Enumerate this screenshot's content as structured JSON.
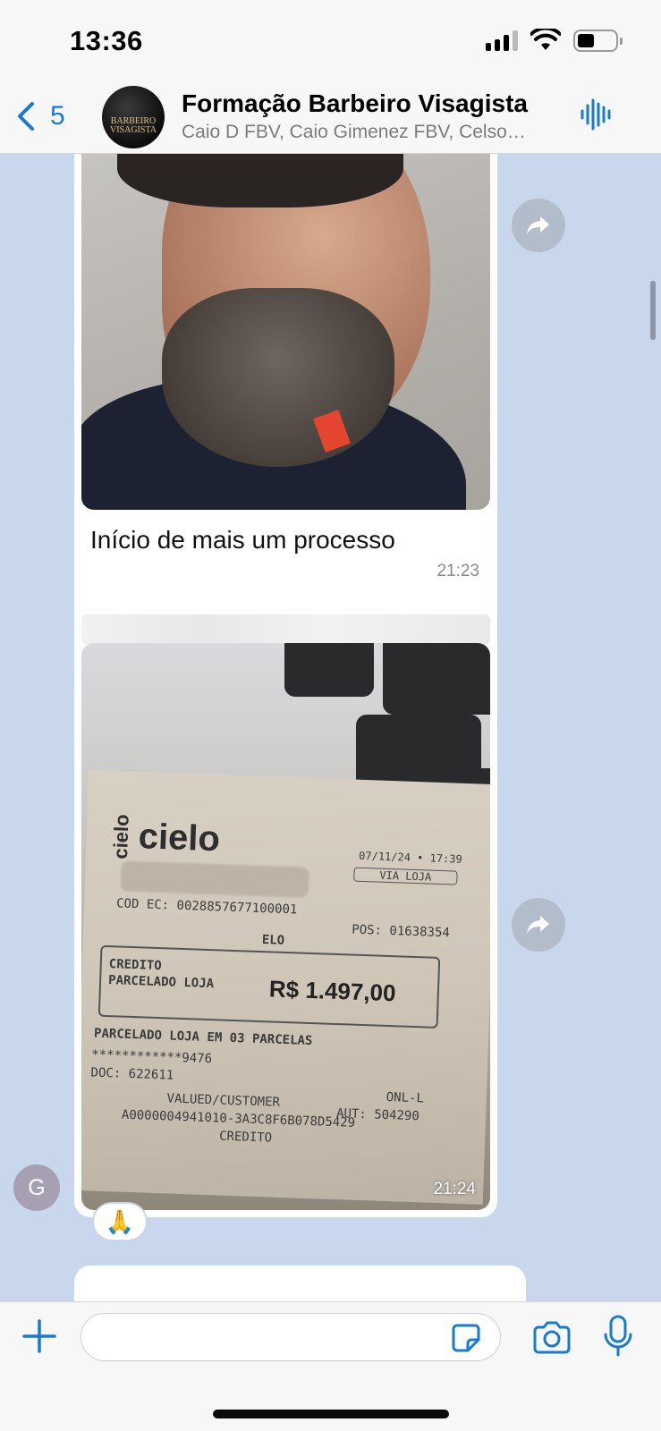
{
  "status_bar": {
    "time": "13:36",
    "battery_level_pct": 45
  },
  "header": {
    "back_count": "5",
    "title": "Formação Barbeiro Visagista",
    "members": "Caio D FBV, Caio Gimenez FBV, Celso…",
    "avatar_logo_line1": "BARBEIRO",
    "avatar_logo_line2": "VISAGISTA",
    "icons": [
      "chevron-left-icon",
      "voice-wave-icon"
    ]
  },
  "messages": [
    {
      "type": "image",
      "caption": "Início de mais um processo",
      "time": "21:23"
    },
    {
      "type": "image",
      "time": "21:24",
      "reaction": "🙏",
      "sender_initial": "G",
      "receipt": {
        "brand": "cielo",
        "datetime": "07/11/24 • 17:39",
        "via": "VIA LOJA",
        "cod_ec": "COD EC: 0028857677100001",
        "pos": "POS: 01638354",
        "card_brand": "ELO",
        "type_line1": "CREDITO",
        "type_line2": "PARCELADO LOJA",
        "amount": "R$ 1.497,00",
        "installments": "PARCELADO LOJA EM 03 PARCELAS",
        "card_mask": "************9476",
        "doc": "DOC: 622611",
        "onl": "ONL-L",
        "aut": "AUT: 504290",
        "customer": "VALUED/CUSTOMER",
        "aid": "A0000004941010-3A3C8F6B078D5429",
        "credito": "CREDITO"
      }
    }
  ],
  "input": {
    "placeholder": ""
  }
}
